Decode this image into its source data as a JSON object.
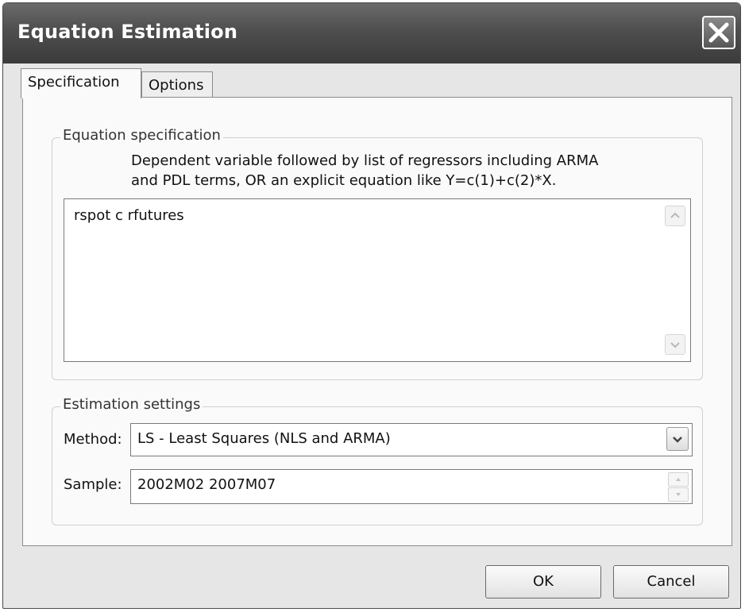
{
  "window": {
    "title": "Equation Estimation",
    "close_icon": "close-icon"
  },
  "tabs": [
    {
      "label": "Specification",
      "active": true
    },
    {
      "label": "Options",
      "active": false
    }
  ],
  "equation_spec": {
    "legend": "Equation specification",
    "description_line1": "Dependent variable followed by list of regressors including ARMA",
    "description_line2": "and PDL terms, OR an explicit equation like Y=c(1)+c(2)*X.",
    "value": "rspot c rfutures"
  },
  "estimation_settings": {
    "legend": "Estimation settings",
    "method_label": "Method:",
    "method_value": "LS  -  Least Squares (NLS and ARMA)",
    "sample_label": "Sample:",
    "sample_value": "2002M02 2007M07"
  },
  "buttons": {
    "ok": "OK",
    "cancel": "Cancel"
  },
  "colors": {
    "titlebar": "#4e4e4e",
    "dialog_bg": "#e6e6e6",
    "panel_bg": "#fafafa"
  }
}
